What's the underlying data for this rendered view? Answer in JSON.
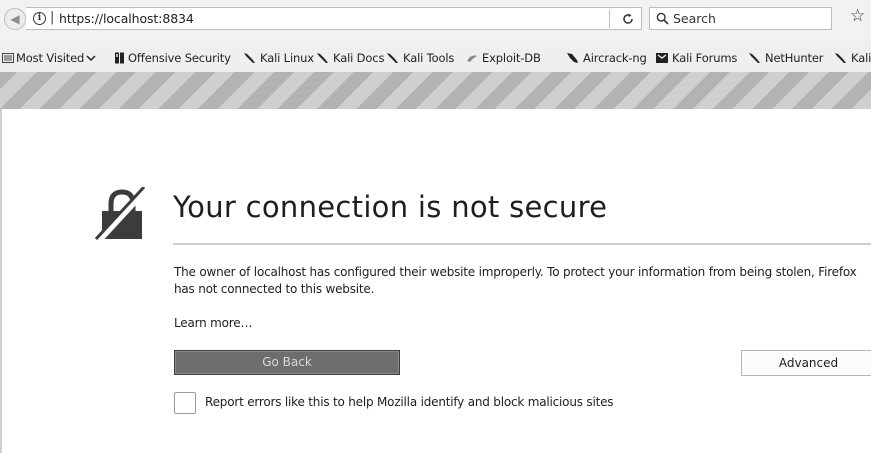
{
  "nav": {
    "url_prefix": "https://",
    "url_host": "localhost:8834",
    "search_placeholder": "Search"
  },
  "bookmarks": [
    {
      "label": "Most Visited",
      "icon": "bookmark-folder-icon",
      "has_dropdown": true
    },
    {
      "label": "Offensive Security",
      "icon": "offsec-icon"
    },
    {
      "label": "Kali Linux",
      "icon": "kali-dragon-icon"
    },
    {
      "label": "Kali Docs",
      "icon": "kali-dragon-icon"
    },
    {
      "label": "Kali Tools",
      "icon": "kali-dragon-icon"
    },
    {
      "label": "Exploit-DB",
      "icon": "exploitdb-icon"
    },
    {
      "label": "Aircrack-ng",
      "icon": "aircrack-icon"
    },
    {
      "label": "Kali Forums",
      "icon": "kali-forums-icon"
    },
    {
      "label": "NetHunter",
      "icon": "kali-dragon-icon"
    },
    {
      "label": "Kali",
      "icon": "kali-dragon-icon"
    }
  ],
  "error": {
    "title": "Your connection is not secure",
    "description": "The owner of localhost has configured their website improperly. To protect your information from being stolen, Firefox has not connected to this website.",
    "learn_more": "Learn more…",
    "go_back_label": "Go Back",
    "advanced_label": "Advanced",
    "report_label": "Report errors like this to help Mozilla identify and block malicious sites",
    "report_checked": false
  }
}
